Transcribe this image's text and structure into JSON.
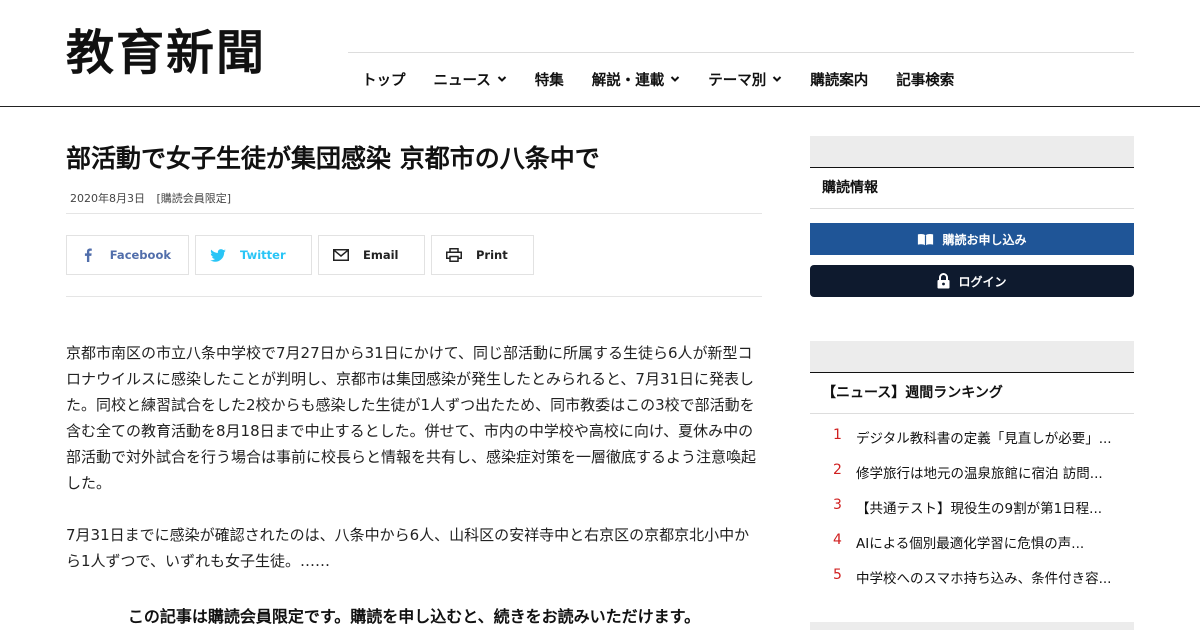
{
  "site": {
    "logo_text": "教育新聞"
  },
  "nav": {
    "items": [
      {
        "label": "トップ",
        "dropdown": false
      },
      {
        "label": "ニュース",
        "dropdown": true
      },
      {
        "label": "特集",
        "dropdown": false
      },
      {
        "label": "解説・連載",
        "dropdown": true
      },
      {
        "label": "テーマ別",
        "dropdown": true
      },
      {
        "label": "購読案内",
        "dropdown": false
      },
      {
        "label": "記事検索",
        "dropdown": false
      }
    ]
  },
  "article": {
    "title": "部活動で女子生徒が集団感染 京都市の八条中で",
    "date": "2020年8月3日",
    "tag": "[購読会員限定]",
    "share": {
      "facebook": "Facebook",
      "twitter": "Twitter",
      "email": "Email",
      "print": "Print"
    },
    "paragraphs": [
      "京都市南区の市立八条中学校で7月27日から31日にかけて、同じ部活動に所属する生徒ら6人が新型コロナウイルスに感染したことが判明し、京都市は集団感染が発生したとみられると、7月31日に発表した。同校と練習試合をした2校からも感染した生徒が1人ずつ出たため、同市教委はこの3校で部活動を含む全ての教育活動を8月18日まで中止するとした。併せて、市内の中学校や高校に向け、夏休み中の部活動で対外試合を行う場合は事前に校長らと情報を共有し、感染症対策を一層徹底するよう注意喚起した。",
      "7月31日までに感染が確認されたのは、八条中から6人、山科区の安祥寺中と右京区の京都京北小中から1人ずつで、いずれも女子生徒。……"
    ],
    "notice": "この記事は購読会員限定です。購読を申し込むと、続きをお読みいただけます。"
  },
  "sidebar": {
    "subscription_heading": "購読情報",
    "subscribe_button": "購読お申し込み",
    "login_button": "ログイン",
    "ranking_heading": "【ニュース】週間ランキング",
    "ranking": [
      {
        "rank": "1",
        "title": "デジタル教科書の定義「見直しが必要」..."
      },
      {
        "rank": "2",
        "title": "修学旅行は地元の温泉旅館に宿泊 訪問..."
      },
      {
        "rank": "3",
        "title": "【共通テスト】現役生の9割が第1日程..."
      },
      {
        "rank": "4",
        "title": "AIによる個別最適化学習に危惧の声..."
      },
      {
        "rank": "5",
        "title": "中学校へのスマホ持ち込み、条件付き容..."
      }
    ]
  },
  "colors": {
    "subscribe_bg": "#1f5597",
    "login_bg": "#0e1a2e",
    "facebook": "#516eab",
    "twitter": "#29c5f6",
    "rank_number": "#d02020"
  }
}
